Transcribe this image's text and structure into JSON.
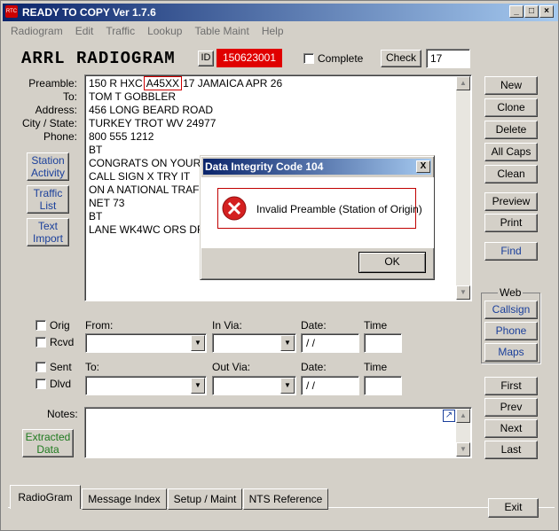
{
  "window": {
    "title": "READY TO COPY Ver 1.7.6",
    "icon": "app-logo-icon"
  },
  "menu": [
    "Radiogram",
    "Edit",
    "Traffic",
    "Lookup",
    "Table Maint",
    "Help"
  ],
  "header": {
    "title": "ARRL RADIOGRAM",
    "id_label": "ID",
    "id_value": "150623001",
    "complete_label": "Complete",
    "check_label": "Check",
    "check_value": "17"
  },
  "fields": {
    "preamble": "Preamble:",
    "to": "To:",
    "address": "Address:",
    "city_state": "City / State:",
    "phone": "Phone:"
  },
  "message": {
    "preamble_pre": "150 R HXC",
    "preamble_box": "A45XX",
    "preamble_post": "17 JAMAICA APR 26",
    "lines": [
      "TOM T GOBBLER",
      "456 LONG BEARD ROAD",
      "TURKEY TROT WV 24977",
      "800 555 1212",
      "BT",
      "CONGRATS ON YOUR",
      "CALL SIGN X TRY IT",
      "ON A NATIONAL TRAFI",
      "NET 73",
      "BT",
      "LANE WK4WC ORS DF"
    ]
  },
  "left_buttons": {
    "station": [
      "Station",
      "Activity"
    ],
    "traffic": [
      "Traffic",
      "List"
    ],
    "text": [
      "Text",
      "Import"
    ]
  },
  "right_buttons": [
    "New",
    "Clone",
    "Delete",
    "All Caps",
    "Clean",
    "Preview",
    "Print",
    "Find"
  ],
  "web": {
    "label": "Web",
    "buttons": [
      "Callsign",
      "Phone",
      "Maps"
    ]
  },
  "nav_buttons": [
    "First",
    "Prev",
    "Next",
    "Last"
  ],
  "exit_label": "Exit",
  "routing": {
    "orig": "Orig",
    "rcvd": "Rcvd",
    "sent": "Sent",
    "dlvd": "Dlvd",
    "from": "From:",
    "in_via": "In Via:",
    "to": "To:",
    "out_via": "Out Via:",
    "date": "Date:",
    "time": "Time",
    "date_value": " / /"
  },
  "notes_label": "Notes:",
  "extracted": [
    "Extracted",
    "Data"
  ],
  "tabs": [
    "RadioGram",
    "Message Index",
    "Setup / Maint",
    "NTS Reference"
  ],
  "dialog": {
    "title": "Data Integrity Code 104",
    "message": "Invalid Preamble (Station of Origin)",
    "ok": "OK",
    "close": "X"
  }
}
